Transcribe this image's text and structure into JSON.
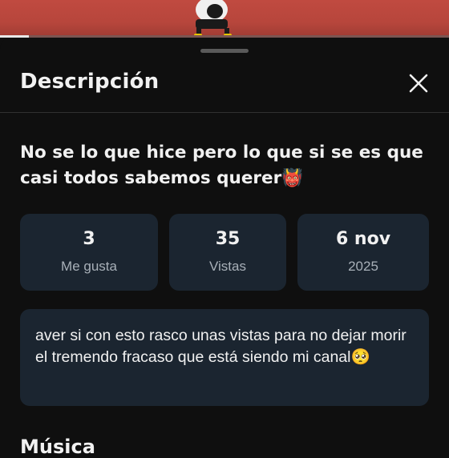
{
  "video": {
    "progress_fraction": 0.065
  },
  "sheet": {
    "title": "Descripción",
    "close_icon": "close-icon"
  },
  "video_info": {
    "title": "No se lo que hice pero lo que si se es que casi todos sabemos querer👹",
    "stats": [
      {
        "value": "3",
        "label": "Me gusta"
      },
      {
        "value": "35",
        "label": "Vistas"
      },
      {
        "value": "6 nov",
        "label": "2025"
      }
    ],
    "description": "aver si con esto rasco unas vistas para no dejar morir el tremendo fracaso que está siendo mi canal🥺"
  },
  "music": {
    "section_title": "Música"
  },
  "colors": {
    "sheet_bg": "#0f0f0f",
    "card_bg": "#1b2530",
    "video_bg": "#b7463c"
  }
}
